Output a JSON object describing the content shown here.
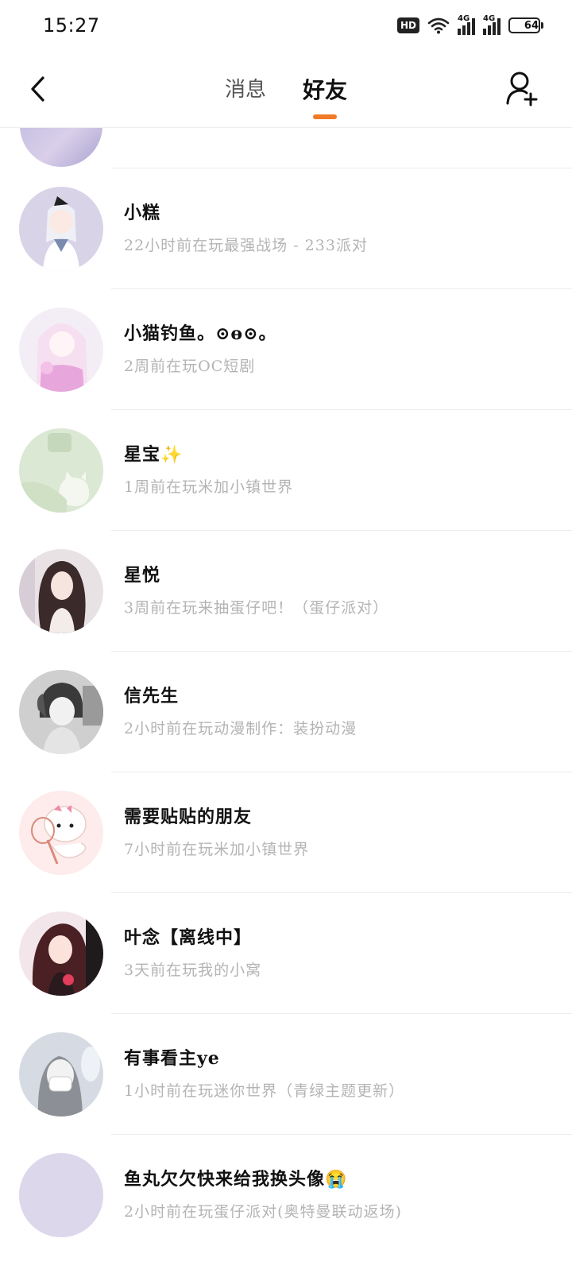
{
  "status_bar": {
    "time": "15:27",
    "hd_label": "HD",
    "network_1": "4G",
    "network_2": "4G",
    "battery": "64",
    "battery_level_percent": 64
  },
  "header": {
    "tabs": [
      {
        "label": "消息",
        "active": false
      },
      {
        "label": "好友",
        "active": true
      }
    ],
    "accent_color": "#f07a25",
    "back_icon": "chevron-left-icon",
    "add_friend_icon": "add-user-icon"
  },
  "friends": [
    {
      "name": "小糕",
      "status": "22小时前在玩最强战场 - 233派对"
    },
    {
      "name": "小猫钓鱼。⊙ө⊙。",
      "status": "2周前在玩OC短剧"
    },
    {
      "name": "星宝✨",
      "status": "1周前在玩米加小镇世界"
    },
    {
      "name": "星悦",
      "status": "3周前在玩来抽蛋仔吧！（蛋仔派对）"
    },
    {
      "name": "信先生",
      "status": "2小时前在玩动漫制作：装扮动漫"
    },
    {
      "name": "需要贴贴的朋友",
      "status": "7小时前在玩米加小镇世界"
    },
    {
      "name": "叶念【离线中】",
      "status": "3天前在玩我的小窝"
    },
    {
      "name": "有事看主ye",
      "status": "1小时前在玩迷你世界（青绿主题更新）"
    },
    {
      "name": "鱼丸欠欠快来给我换头像😭",
      "status": "2小时前在玩蛋仔派对(奥特曼联动返场)"
    }
  ]
}
